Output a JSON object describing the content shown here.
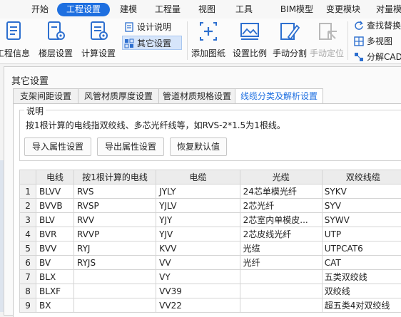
{
  "menu": {
    "items": [
      {
        "label": "开始",
        "active": false
      },
      {
        "label": "工程设置",
        "active": true
      },
      {
        "label": "建模",
        "active": false
      },
      {
        "label": "工程量",
        "active": false
      },
      {
        "label": "视图",
        "active": false
      },
      {
        "label": "工具",
        "active": false
      },
      {
        "label": "BIM模型",
        "active": false
      },
      {
        "label": "变更模块",
        "active": false
      },
      {
        "label": "对量模",
        "active": false
      }
    ]
  },
  "ribbon": {
    "project_info": "工程信息",
    "floor_settings": "楼层设置",
    "calc_settings": "计算设置",
    "design_notes": "设计说明",
    "other_settings": "其它设置",
    "add_drawing": "添加图纸",
    "set_scale": "设置比例",
    "manual_split": "手动分割",
    "manual_locate": "手动定位",
    "find_replace": "查找替换",
    "multi_view": "多视图",
    "decompose_cad": "分解CAD"
  },
  "dialog": {
    "title": "其它设置",
    "tabs": [
      {
        "label": "支架间距设置",
        "active": false
      },
      {
        "label": "风管材质厚度设置",
        "active": false
      },
      {
        "label": "管道材质规格设置",
        "active": false
      },
      {
        "label": "线缆分类及解析设置",
        "active": true
      }
    ],
    "group_legend": "说明",
    "description": "按1根计算的电线指双绞线、多芯光纤线等，如RVS-2*1.5为1根线。",
    "buttons": {
      "import": "导入属性设置",
      "export": "导出属性设置",
      "restore": "恢复默认值"
    }
  },
  "table": {
    "headers": [
      "",
      "电线",
      "按1根计算的电线",
      "电缆",
      "光缆",
      "双绞线缆"
    ],
    "rows": [
      [
        "1",
        "BLVV",
        "RVS",
        "JYLY",
        "24芯单模光纤",
        "SYKV"
      ],
      [
        "2",
        "BVVB",
        "RVSP",
        "YJLV",
        "2芯光纤",
        "SYV"
      ],
      [
        "3",
        "BLV",
        "RVV",
        "YJY",
        "2芯室内单模皮...",
        "SYWV"
      ],
      [
        "4",
        "BVR",
        "RVVP",
        "YJV",
        "2芯皮线光纤",
        "UTP"
      ],
      [
        "5",
        "BVV",
        "RYJ",
        "KVV",
        "光缆",
        "UTPCAT6"
      ],
      [
        "6",
        "BV",
        "RYJS",
        "VV",
        "光纤",
        "CAT"
      ],
      [
        "7",
        "BLX",
        "",
        "VY",
        "",
        "五类双绞线"
      ],
      [
        "8",
        "BLXF",
        "",
        "VV39",
        "",
        "双绞线"
      ],
      [
        "9",
        "BX",
        "",
        "VV22",
        "",
        "超五类4对双绞线"
      ]
    ]
  },
  "colors": {
    "accent": "#1e6fe0",
    "tab_active_text": "#1e6fe0"
  }
}
